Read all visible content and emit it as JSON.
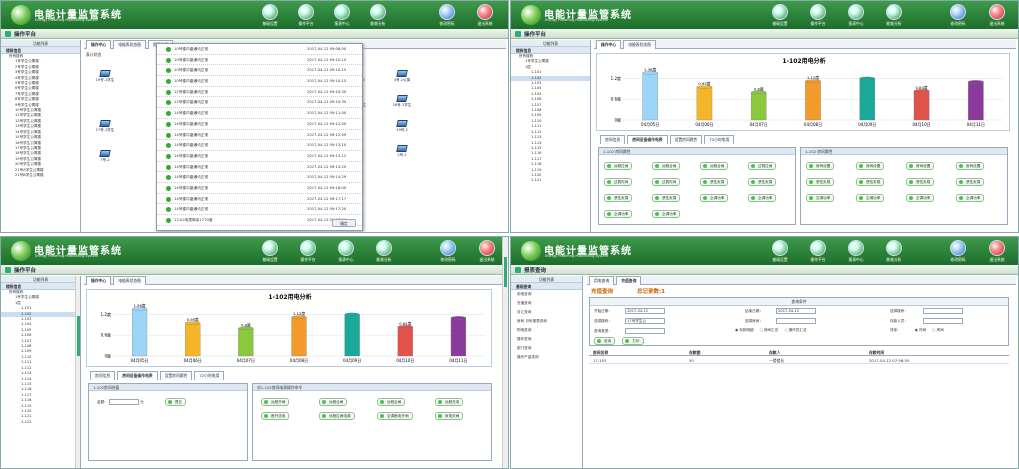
{
  "app": {
    "title": "电能计量监管系统",
    "subtitle": "Energy metering monitoring system"
  },
  "nav": {
    "items": [
      {
        "label": "基础设置",
        "icon": "settings-icon"
      },
      {
        "label": "操作平台",
        "icon": "operation-icon"
      },
      {
        "label": "报表中心",
        "icon": "report-icon"
      },
      {
        "label": "能耗分析",
        "icon": "analysis-icon"
      }
    ],
    "change_pwd": "修改密码",
    "logout": "退出系统"
  },
  "p1": {
    "section": "操作平台",
    "func_list": "功能列表",
    "equip": "楼栋信息",
    "tree_root": "所有楼栋",
    "buildings": [
      "1号学生公寓楼",
      "2号学生公寓楼",
      "3号学生公寓楼",
      "4号学生公寓楼",
      "5号学生公寓楼",
      "6号学生公寓楼",
      "7号学生公寓楼",
      "8号学生公寓楼",
      "9号学生公寓楼",
      "10号学生公寓楼",
      "11号学生公寓楼",
      "12号学生公寓楼",
      "13号学生公寓楼",
      "14号学生公寓楼",
      "15号学生公寓楼",
      "16号学生公寓楼",
      "17号学生公寓楼",
      "18号学生公寓楼",
      "19号学生公寓楼",
      "20号学生公寓楼",
      "21号A学生公寓楼",
      "21号B学生公寓楼"
    ],
    "tabs": [
      "操作中心",
      "电能表状态图",
      "提示信息"
    ],
    "meter_label": "表计状态",
    "meters_left": [
      "19号-1学生",
      "17号-1学生",
      "7号-2"
    ],
    "meters_right": [
      [
        "2号-1公寓楼",
        "21号-1A5",
        "4号-1公寓"
      ],
      [
        "1号-1公寓楼",
        "19号-1学生",
        "16号-1学生"
      ],
      [
        "2号楼-2.7",
        "3号-2",
        "19号-2"
      ],
      [
        "6号-2",
        "1号-2",
        "2号-2"
      ]
    ],
    "messages": [
      [
        "10号楼中晶通讯正常",
        "2017-04-12 09:08:00"
      ],
      [
        "10号楼中晶通讯正常",
        "2017-04-12 09:10:15"
      ],
      [
        "10号楼中晶通讯正常",
        "2017-04-12 09:10:15"
      ],
      [
        "10号楼中晶通讯正常",
        "2017-04-12 09:10:15"
      ],
      [
        "12号楼中晶通讯正常",
        "2017-04-12 09:10:30"
      ],
      [
        "12号楼中晶通讯正常",
        "2017-04-12 09:10:30"
      ],
      [
        "14号楼中晶通讯正常",
        "2017-04-12 09:11:00"
      ],
      [
        "14号楼中晶通讯正常",
        "2017-04-12 09:12:00"
      ],
      [
        "14号楼中晶通讯正常",
        "2017-04-12 09:12:59"
      ],
      [
        "14号楼中晶通讯正常",
        "2017-04-12 09:13:10"
      ],
      [
        "14号楼中晶通讯正常",
        "2017-04-12 09:13:12"
      ],
      [
        "14号楼中晶通讯正常",
        "2017-04-12 09:14:20"
      ],
      [
        "14号楼中晶通讯正常",
        "2017-04-12 09:14:29"
      ],
      [
        "14号楼中晶通讯正常",
        "2017-04-12 09:16:00"
      ],
      [
        "14号楼中晶通讯正常",
        "2017-04-12 09:17:17"
      ],
      [
        "14号楼中晶通讯正常",
        "2017-04-12 09:17:20"
      ],
      [
        "13-02电表剩余1770度",
        "2017-04-12 09:17:00"
      ]
    ],
    "ok": "确定"
  },
  "p2": {
    "section": "操作平台",
    "func_list": "功能列表",
    "equip": "楼栋信息",
    "tree_root": "所有楼栋",
    "building": "1号学生公寓楼",
    "floor": "1层",
    "rooms": [
      "1-101",
      "1-102",
      "1-103",
      "1-104",
      "1-105",
      "1-106",
      "1-107",
      "1-108",
      "1-109",
      "1-110",
      "1-111",
      "1-112",
      "1-113",
      "1-114",
      "1-115",
      "1-116",
      "1-117",
      "1-118",
      "1-119",
      "1-120",
      "1-121"
    ],
    "tabs": [
      "操作中心",
      "电能表状态图"
    ],
    "btabs": [
      "房间信息",
      "房间设备操作电表",
      "设置房间属性",
      "72小时电用"
    ],
    "left_group": "1-102 房间属性",
    "left_btns": [
      "远程拉闸",
      "远程合闸",
      "远程合闸",
      "过载拉闸",
      "过载时间",
      "过载时间",
      "恶性负载",
      "恶性负载",
      "恶性负载",
      "恶性负载",
      "空调功率",
      "空调功率",
      "空调功率",
      "空调功率"
    ],
    "right_group": "1-102 房间属性",
    "right_btns": [
      "房间设置",
      "房间设置",
      "房间设置",
      "房间设置",
      "恶性负载",
      "恶性负载",
      "恶性负载",
      "恶性负载",
      "空调功率",
      "空调功率",
      "空调功率",
      "空调功率"
    ]
  },
  "p3": {
    "section": "操作平台",
    "func_list": "功能列表",
    "equip": "楼栋信息",
    "tree_root": "所有楼栋",
    "building": "1号学生公寓楼",
    "floor": "1层",
    "rooms": [
      "1-101",
      "1-102",
      "1-103",
      "1-104",
      "1-105",
      "1-106",
      "1-107",
      "1-108",
      "1-109",
      "1-110",
      "1-111",
      "1-112",
      "1-113",
      "1-114",
      "1-115",
      "1-116",
      "1-117",
      "1-118",
      "1-119",
      "1-120",
      "1-121",
      "1-122"
    ],
    "tabs": [
      "操作中心",
      "电能表状态图"
    ],
    "btabs": [
      "房间信息",
      "房间设备操作电表",
      "设置房间属性",
      "72小时电用"
    ],
    "recharge_title": "1-102房间充值",
    "amount_label": "金额：",
    "unit": "元",
    "submit": "提交",
    "cmd_title": "对1-102房间电表操作命令",
    "cmds": [
      "远程开闸",
      "远程合闸",
      "远程合闸",
      "远程充电",
      "断开送电",
      "远程拉闸电源",
      "空调断电开闸",
      "家电关闸"
    ]
  },
  "p4": {
    "section": "报表查询",
    "func_list": "功能列表",
    "equip": "基础查询",
    "menu": [
      "用电查询",
      "充值查询",
      "月汇查询",
      "房间 月份报表查询",
      "购电查询",
      "操作查询",
      "部门查询",
      "操作产量查询"
    ],
    "tabs": [
      "用电查询",
      "充值查询"
    ],
    "title": "充值查询",
    "total_label": "总记录数:1",
    "cond_title": "查询条件",
    "start_label": "开始日期：",
    "start_val": "2017-04-12",
    "end_label": "结束日期：",
    "end_val": "2017-04-12",
    "building_label": "选择楼栋：",
    "building_val": "17号学生公",
    "room_label": "选择房间：",
    "floor_label": "选择楼层：",
    "operator_label": "存款人员：",
    "query_type": "查询类型：",
    "radios": [
      "存款明细",
      "房间汇总",
      "操作员汇总"
    ],
    "sort_label": "排序：",
    "sort_opts": [
      "时间",
      "房间"
    ],
    "query_btn": "查询",
    "export_btn": "打印",
    "cols": [
      "房间名称",
      "存款额",
      "存款人",
      "存款时间"
    ],
    "rows": [
      [
        "17-103",
        "50",
        "一楼楼长",
        "2017-04-12 07:56:55"
      ]
    ]
  },
  "chart_data": [
    {
      "type": "bar",
      "title": "1-102用电分析",
      "categories": [
        "04月05日",
        "04月06日",
        "04月07日",
        "04月08日",
        "04月09日",
        "04月10日",
        "04月11日"
      ],
      "values": [
        1.36,
        0.95,
        0.8,
        1.12,
        1.2,
        0.84,
        1.1
      ],
      "data_labels": [
        "1.36度",
        "0.95度",
        "0.8度",
        "1.12度",
        "",
        "0.84度",
        ""
      ],
      "yticks": [
        "1.2度",
        "0.6度",
        "0度"
      ],
      "colors": [
        "#9cd6f6",
        "#f5b52a",
        "#8ac93e",
        "#f39a2c",
        "#1aa89a",
        "#e0524a",
        "#8a3a9c"
      ]
    },
    {
      "type": "bar",
      "title": "1-102用电分析",
      "categories": [
        "04月05日",
        "04月06日",
        "04月07日",
        "04月08日",
        "04月09日",
        "04月10日",
        "04月11日"
      ],
      "values": [
        1.36,
        0.95,
        0.8,
        1.12,
        1.2,
        0.84,
        1.1
      ],
      "data_labels": [
        "1.36度",
        "0.95度",
        "0.8度",
        "1.12度",
        "",
        "0.84度",
        ""
      ],
      "yticks": [
        "1.2度",
        "0.6度",
        "0度"
      ],
      "colors": [
        "#9cd6f6",
        "#f5b52a",
        "#8ac93e",
        "#f39a2c",
        "#1aa89a",
        "#e0524a",
        "#8a3a9c"
      ]
    }
  ]
}
